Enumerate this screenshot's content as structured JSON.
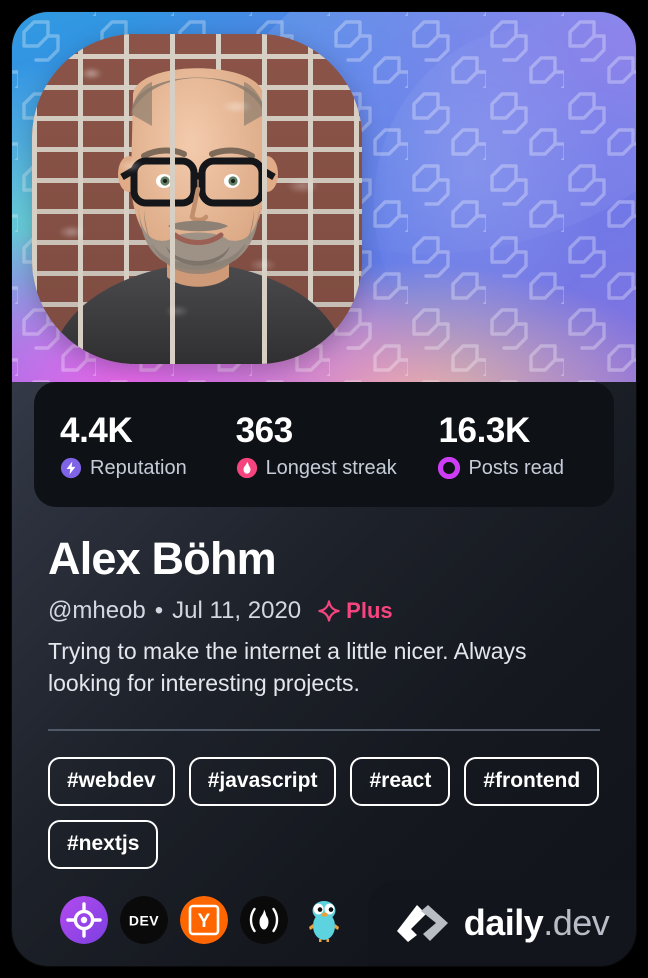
{
  "card": {
    "type": "devcard",
    "theme_colors": {
      "card_bg_top": "#4a5261",
      "card_bg_bottom": "#10131a",
      "stats_bg": "#0e1217",
      "accent_plus": "#f6447f",
      "reputation": "#8064e8",
      "streak": "#f6447f",
      "posts_read": "#cd3df5",
      "tag_border": "#ffffff",
      "divider": "#5a6372"
    }
  },
  "cover": {
    "name": "cover-image",
    "gradient": [
      "#2f9ae0",
      "#5d7ee8",
      "#8a6fe0",
      "#ec66e8"
    ],
    "pattern_icon": "daily-dev-logo-watermark"
  },
  "avatar": {
    "name": "profile-avatar",
    "alt": "Portrait photo of a bearded man with glasses in front of a brick wall"
  },
  "stats": [
    {
      "value": "4.4K",
      "label": "Reputation",
      "icon": "bolt-icon",
      "color": "#8064e8"
    },
    {
      "value": "363",
      "label": "Longest streak",
      "icon": "flame-icon",
      "color": "#f6447f"
    },
    {
      "value": "16.3K",
      "label": "Posts read",
      "icon": "ring-icon",
      "color": "#cd3df5"
    }
  ],
  "profile": {
    "display_name": "Alex Böhm",
    "username": "@mheob",
    "separator": "•",
    "joined_date": "Jul 11, 2020",
    "plus_label": "Plus",
    "plus_icon": "sparkle-icon",
    "bio": "Trying to make the internet a little nicer. Always looking for interesting projects."
  },
  "tags": [
    {
      "label": "#webdev"
    },
    {
      "label": "#javascript"
    },
    {
      "label": "#react"
    },
    {
      "label": "#frontend"
    },
    {
      "label": "#nextjs"
    }
  ],
  "sources": [
    {
      "name": "source-icon-target",
      "title": "target-crosshair-icon"
    },
    {
      "name": "source-icon-devto",
      "title": "DEV"
    },
    {
      "name": "source-icon-ycombinator",
      "title": "Y"
    },
    {
      "name": "source-icon-hashnode",
      "title": "flame-parentheses-icon"
    },
    {
      "name": "source-icon-golang",
      "title": "go-gopher-icon"
    }
  ],
  "branding": {
    "logo_icon": "daily-dev-chevron-logo",
    "word_primary": "daily",
    "word_secondary": ".dev"
  }
}
